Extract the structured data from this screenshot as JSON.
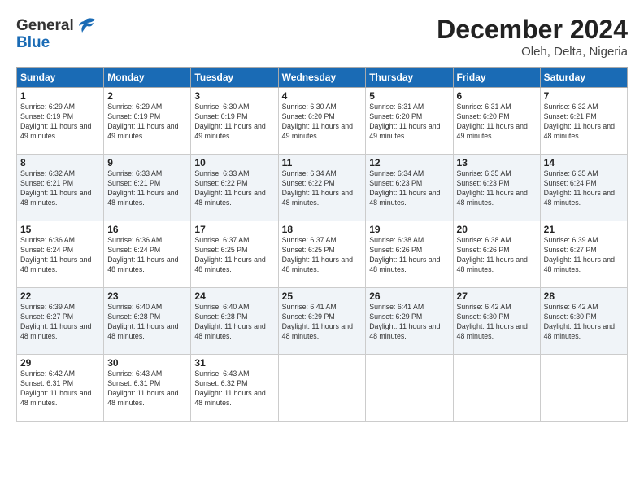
{
  "logo": {
    "line1": "General",
    "line2": "Blue"
  },
  "header": {
    "month": "December 2024",
    "location": "Oleh, Delta, Nigeria"
  },
  "weekdays": [
    "Sunday",
    "Monday",
    "Tuesday",
    "Wednesday",
    "Thursday",
    "Friday",
    "Saturday"
  ],
  "weeks": [
    [
      {
        "day": "1",
        "rise": "6:29 AM",
        "set": "6:19 PM",
        "daylight": "11 hours and 49 minutes."
      },
      {
        "day": "2",
        "rise": "6:29 AM",
        "set": "6:19 PM",
        "daylight": "11 hours and 49 minutes."
      },
      {
        "day": "3",
        "rise": "6:30 AM",
        "set": "6:19 PM",
        "daylight": "11 hours and 49 minutes."
      },
      {
        "day": "4",
        "rise": "6:30 AM",
        "set": "6:20 PM",
        "daylight": "11 hours and 49 minutes."
      },
      {
        "day": "5",
        "rise": "6:31 AM",
        "set": "6:20 PM",
        "daylight": "11 hours and 49 minutes."
      },
      {
        "day": "6",
        "rise": "6:31 AM",
        "set": "6:20 PM",
        "daylight": "11 hours and 49 minutes."
      },
      {
        "day": "7",
        "rise": "6:32 AM",
        "set": "6:21 PM",
        "daylight": "11 hours and 48 minutes."
      }
    ],
    [
      {
        "day": "8",
        "rise": "6:32 AM",
        "set": "6:21 PM",
        "daylight": "11 hours and 48 minutes."
      },
      {
        "day": "9",
        "rise": "6:33 AM",
        "set": "6:21 PM",
        "daylight": "11 hours and 48 minutes."
      },
      {
        "day": "10",
        "rise": "6:33 AM",
        "set": "6:22 PM",
        "daylight": "11 hours and 48 minutes."
      },
      {
        "day": "11",
        "rise": "6:34 AM",
        "set": "6:22 PM",
        "daylight": "11 hours and 48 minutes."
      },
      {
        "day": "12",
        "rise": "6:34 AM",
        "set": "6:23 PM",
        "daylight": "11 hours and 48 minutes."
      },
      {
        "day": "13",
        "rise": "6:35 AM",
        "set": "6:23 PM",
        "daylight": "11 hours and 48 minutes."
      },
      {
        "day": "14",
        "rise": "6:35 AM",
        "set": "6:24 PM",
        "daylight": "11 hours and 48 minutes."
      }
    ],
    [
      {
        "day": "15",
        "rise": "6:36 AM",
        "set": "6:24 PM",
        "daylight": "11 hours and 48 minutes."
      },
      {
        "day": "16",
        "rise": "6:36 AM",
        "set": "6:24 PM",
        "daylight": "11 hours and 48 minutes."
      },
      {
        "day": "17",
        "rise": "6:37 AM",
        "set": "6:25 PM",
        "daylight": "11 hours and 48 minutes."
      },
      {
        "day": "18",
        "rise": "6:37 AM",
        "set": "6:25 PM",
        "daylight": "11 hours and 48 minutes."
      },
      {
        "day": "19",
        "rise": "6:38 AM",
        "set": "6:26 PM",
        "daylight": "11 hours and 48 minutes."
      },
      {
        "day": "20",
        "rise": "6:38 AM",
        "set": "6:26 PM",
        "daylight": "11 hours and 48 minutes."
      },
      {
        "day": "21",
        "rise": "6:39 AM",
        "set": "6:27 PM",
        "daylight": "11 hours and 48 minutes."
      }
    ],
    [
      {
        "day": "22",
        "rise": "6:39 AM",
        "set": "6:27 PM",
        "daylight": "11 hours and 48 minutes."
      },
      {
        "day": "23",
        "rise": "6:40 AM",
        "set": "6:28 PM",
        "daylight": "11 hours and 48 minutes."
      },
      {
        "day": "24",
        "rise": "6:40 AM",
        "set": "6:28 PM",
        "daylight": "11 hours and 48 minutes."
      },
      {
        "day": "25",
        "rise": "6:41 AM",
        "set": "6:29 PM",
        "daylight": "11 hours and 48 minutes."
      },
      {
        "day": "26",
        "rise": "6:41 AM",
        "set": "6:29 PM",
        "daylight": "11 hours and 48 minutes."
      },
      {
        "day": "27",
        "rise": "6:42 AM",
        "set": "6:30 PM",
        "daylight": "11 hours and 48 minutes."
      },
      {
        "day": "28",
        "rise": "6:42 AM",
        "set": "6:30 PM",
        "daylight": "11 hours and 48 minutes."
      }
    ],
    [
      {
        "day": "29",
        "rise": "6:42 AM",
        "set": "6:31 PM",
        "daylight": "11 hours and 48 minutes."
      },
      {
        "day": "30",
        "rise": "6:43 AM",
        "set": "6:31 PM",
        "daylight": "11 hours and 48 minutes."
      },
      {
        "day": "31",
        "rise": "6:43 AM",
        "set": "6:32 PM",
        "daylight": "11 hours and 48 minutes."
      },
      null,
      null,
      null,
      null
    ]
  ]
}
